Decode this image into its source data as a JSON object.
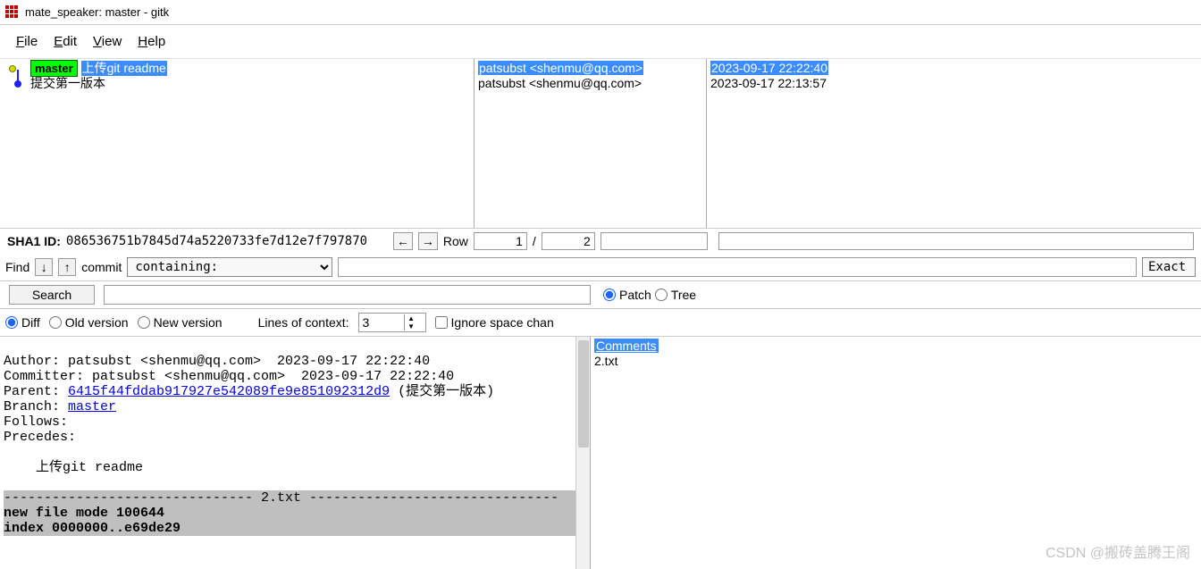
{
  "window": {
    "title": "mate_speaker: master - gitk"
  },
  "menu": {
    "file": "File",
    "edit": "Edit",
    "view": "View",
    "help": "Help"
  },
  "history": {
    "branch_tag": "master",
    "rows": [
      {
        "message": "上传git readme",
        "author": "patsubst <shenmu@qq.com>",
        "date": "2023-09-17 22:22:40",
        "selected": true,
        "has_branch": true
      },
      {
        "message": "提交第一版本",
        "author": "patsubst <shenmu@qq.com>",
        "date": "2023-09-17 22:13:57",
        "selected": false,
        "has_branch": false
      }
    ]
  },
  "sha": {
    "label": "SHA1 ID:",
    "value": "086536751b7845d74a5220733fe7d12e7f797870",
    "row_label": "Row",
    "row_current": "1",
    "row_sep": "/",
    "row_total": "2"
  },
  "find": {
    "label": "Find",
    "mode_label": "commit",
    "containing": "containing:",
    "exact": "Exact"
  },
  "search": {
    "button": "Search"
  },
  "patch_tree": {
    "patch": "Patch",
    "tree": "Tree"
  },
  "diff_opts": {
    "diff": "Diff",
    "old": "Old version",
    "new": "New version",
    "lines_label": "Lines of context:",
    "lines_value": "3",
    "ignore": "Ignore space chan"
  },
  "commit_details": {
    "author_line": "Author: patsubst <shenmu@qq.com>  2023-09-17 22:22:40",
    "committer_line": "Committer: patsubst <shenmu@qq.com>  2023-09-17 22:22:40",
    "parent_label": "Parent: ",
    "parent_hash": "6415f44fddab917927e542089fe9e851092312d9",
    "parent_msg": " (提交第一版本)",
    "branch_label": "Branch: ",
    "branch_name": "master",
    "follows": "Follows:",
    "precedes": "Precedes:",
    "message": "    上传git readme",
    "file_header": "------------------------------- 2.txt -------------------------------",
    "mode_line": "new file mode 100644",
    "index_line": "index 0000000..e69de29"
  },
  "tree": {
    "comments": "Comments",
    "file": "2.txt"
  },
  "watermark": "CSDN @搬砖盖腾王阁"
}
